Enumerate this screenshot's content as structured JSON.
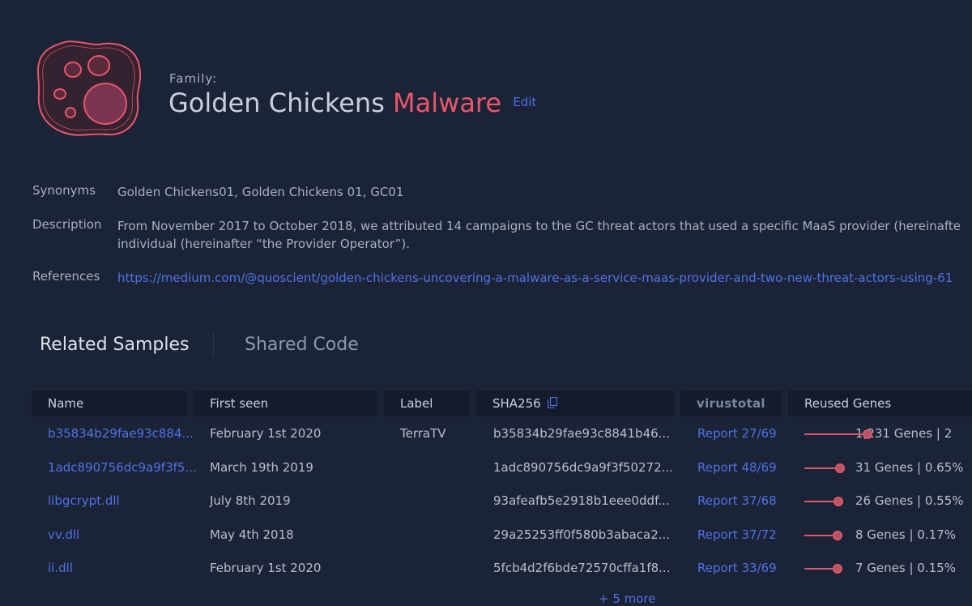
{
  "header": {
    "family_label": "Family:",
    "family_name": "Golden Chickens",
    "family_kind": "Malware",
    "edit_label": "Edit"
  },
  "meta": {
    "synonyms_key": "Synonyms",
    "synonyms_value": "Golden Chickens01, Golden Chickens 01, GC01",
    "description_key": "Description",
    "description_line1": "From November 2017 to October 2018, we attributed 14 campaigns to the GC threat actors that used a specific MaaS provider (hereinafte",
    "description_line2": "individual (hereinafter “the Provider Operator”).",
    "references_key": "References",
    "references_value": "https://medium.com/@quoscient/golden-chickens-uncovering-a-malware-as-a-service-maas-provider-and-two-new-threat-actors-using-61"
  },
  "tabs": [
    {
      "label": "Related Samples",
      "active": true
    },
    {
      "label": "Shared Code",
      "active": false
    }
  ],
  "table": {
    "columns": [
      "Name",
      "First seen",
      "Label",
      "SHA256",
      "virustotal",
      "Reused Genes"
    ],
    "rows": [
      {
        "name": "b35834b29fae93c884...",
        "first_seen": "February 1st 2020",
        "label": "TerraTV",
        "sha256": "b35834b29fae93c8841b46...",
        "report": "Report 27/69",
        "genes": "1,231 Genes | 2",
        "gene_level": 1.0
      },
      {
        "name": "1adc890756dc9a9f3f5...",
        "first_seen": "March 19th 2019",
        "label": "",
        "sha256": "1adc890756dc9a9f3f50272...",
        "report": "Report 48/69",
        "genes": "31 Genes | 0.65%",
        "gene_level": 0.56
      },
      {
        "name": "libgcrypt.dll",
        "first_seen": "July 8th 2019",
        "label": "",
        "sha256": "93afeafb5e2918b1eee0ddf...",
        "report": "Report 37/68",
        "genes": "26 Genes | 0.55%",
        "gene_level": 0.54
      },
      {
        "name": "vv.dll",
        "first_seen": "May 4th 2018",
        "label": "",
        "sha256": "29a25253ff0f580b3abaca2...",
        "report": "Report 37/72",
        "genes": "8 Genes | 0.17%",
        "gene_level": 0.53
      },
      {
        "name": "ii.dll",
        "first_seen": "February 1st 2020",
        "label": "",
        "sha256": "5fcb4d2f6bde72570cffa1f8...",
        "report": "Report 33/69",
        "genes": "7 Genes | 0.15%",
        "gene_level": 0.53
      }
    ],
    "more_label": "+ 5 more"
  },
  "icons": {
    "logo": "paw-icon",
    "copy": "copy-icon"
  },
  "colors": {
    "background": "#1b2336",
    "header_bg": "#141b2b",
    "accent_red": "#ea566b",
    "link_blue": "#4f73e8"
  }
}
